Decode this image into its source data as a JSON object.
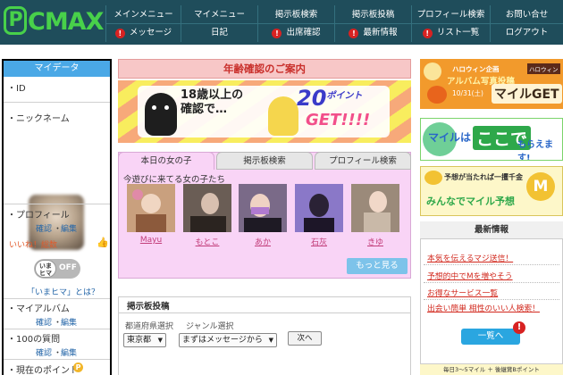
{
  "brand": {
    "logo_text": "CMAX",
    "logo_p": "P"
  },
  "nav": {
    "row1": [
      "メインメニュー",
      "マイメニュー",
      "掲示板検索",
      "掲示板投稿",
      "プロフィール検索",
      "お問い合せ"
    ],
    "row2": [
      "メッセージ",
      "日記",
      "出席確認",
      "最新情報",
      "リスト一覧",
      "ログアウト"
    ],
    "alert_mark": "!"
  },
  "sidebar": {
    "header": "マイデータ",
    "id_label": "・ID",
    "nickname_label": "・ニックネーム",
    "profile_label": "・プロフィール",
    "confirm_link": "確認",
    "edit_link": "編集",
    "link_separator": "・",
    "iine_text": "いいね！総数",
    "imahima_toggle_top": "いま",
    "imahima_toggle_bottom": "ヒマ",
    "imahima_state": "OFF",
    "imahima_link": "「いまヒマ」とは？",
    "album_label": "・マイアルバム",
    "questions_label": "・100の質問",
    "points_label": "・現在のポイント",
    "points_icon": "P",
    "thumb_icon": "👍"
  },
  "main": {
    "age_banner": "年齢確認のご案内",
    "age_ad": {
      "line1": "18歳以上の",
      "line2": "確認で…",
      "points_value": "20",
      "points_unit": "ポイント",
      "get": "GET!!!!"
    },
    "tabs": [
      "本日の女の子",
      "掲示板検索",
      "プロフィール検索"
    ],
    "girls_caption": "今遊びに来てる女の子たち",
    "girls": [
      {
        "name": "Mayu",
        "color": "#c9a07e"
      },
      {
        "name": "もとこ",
        "color": "#6a5d55"
      },
      {
        "name": "あか",
        "color": "#7a6a88"
      },
      {
        "name": "石灰",
        "color": "#8a78c8"
      },
      {
        "name": "きゆ",
        "color": "#9b8a7a"
      }
    ],
    "more_button": "もっと見る",
    "board": {
      "title": "掲示板投稿",
      "pref_label": "都道府県選択",
      "genre_label": "ジャンル選択",
      "pref_value": "東京都",
      "genre_value": "まずはメッセージから",
      "next_button": "次へ"
    }
  },
  "right": {
    "halloween": {
      "tag": "ハロウィン",
      "line1": "ハロウィン企画",
      "line2": "アルバム写真投稿",
      "line3": "10/31(土)",
      "get": "マイルGET"
    },
    "mile_banner": {
      "l1": "マイルは",
      "l2": "ここで",
      "l3": "もらえます!"
    },
    "forecast": {
      "l1": "予想が当たれば一攫千金",
      "l2": "みんなでマイル予想",
      "m": "M"
    },
    "news": {
      "title": "最新情報",
      "items": [
        "本気を伝えるマジ送信！",
        "予想的中でMを増やそう",
        "お得なサービス一覧",
        "出会い簡単 相性のいい人検索！"
      ],
      "list_button": "一覧へ",
      "alert": "!"
    },
    "bottom_ad": "毎日3～5マイル ＋ 後継賞Bポイント"
  }
}
